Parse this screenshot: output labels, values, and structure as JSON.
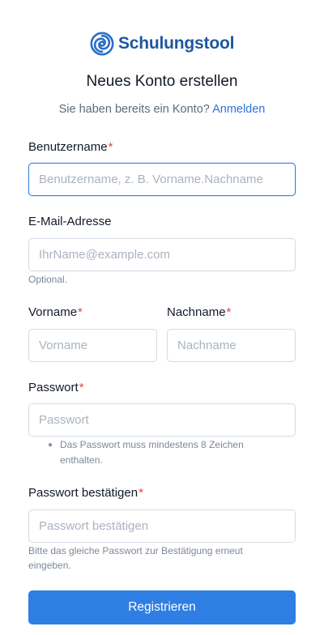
{
  "brand": {
    "name": "Schulungstool",
    "logo_icon": "swirl-logo-icon",
    "color": "#1e56a0"
  },
  "title": "Neues Konto erstellen",
  "login_prompt": {
    "text": "Sie haben bereits ein Konto?",
    "link": "Anmelden"
  },
  "fields": {
    "username": {
      "label": "Benutzername",
      "required": "*",
      "placeholder": "Benutzername, z. B. Vorname.Nachname",
      "value": ""
    },
    "email": {
      "label": "E-Mail-Adresse",
      "placeholder": "IhrName@example.com",
      "value": "",
      "helper": "Optional."
    },
    "firstname": {
      "label": "Vorname",
      "required": "*",
      "placeholder": "Vorname",
      "value": ""
    },
    "lastname": {
      "label": "Nachname",
      "required": "*",
      "placeholder": "Nachname",
      "value": ""
    },
    "password": {
      "label": "Passwort",
      "required": "*",
      "placeholder": "Passwort",
      "value": "",
      "hints": [
        "Das Passwort muss mindestens 8 Zeichen enthalten."
      ]
    },
    "password_confirm": {
      "label": "Passwort bestätigen",
      "required": "*",
      "placeholder": "Passwort bestätigen",
      "value": "",
      "helper": "Bitte das gleiche Passwort zur Bestätigung erneut eingeben."
    }
  },
  "submit_label": "Registrieren",
  "colors": {
    "accent": "#2f7ee4",
    "link": "#2d74d9",
    "required": "#e0463f",
    "focus_border": "#3a80de"
  }
}
